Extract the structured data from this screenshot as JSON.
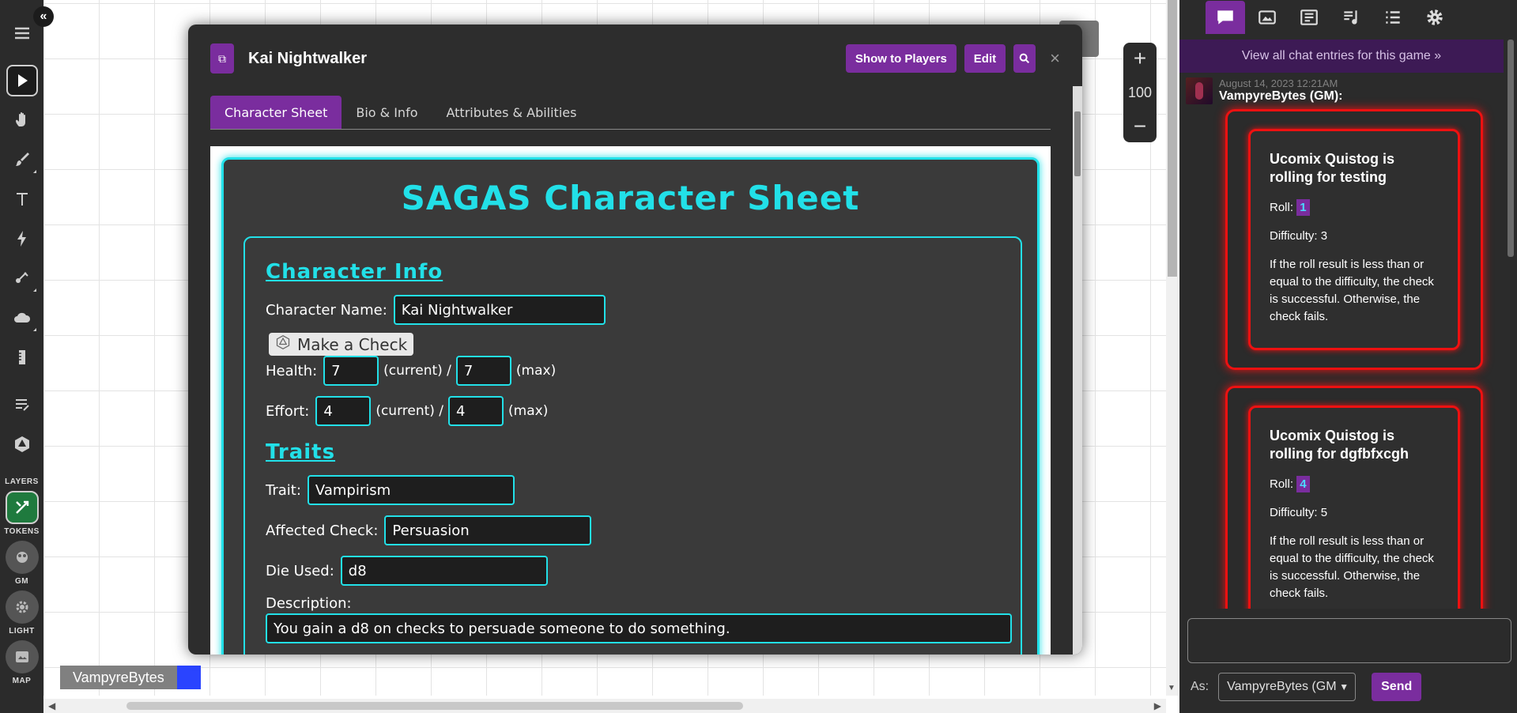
{
  "dialog": {
    "title": "Kai Nightwalker",
    "show_players_label": "Show to Players",
    "edit_label": "Edit",
    "close_glyph": "×",
    "tabs": [
      {
        "label": "Character Sheet"
      },
      {
        "label": "Bio & Info"
      },
      {
        "label": "Attributes & Abilities"
      }
    ]
  },
  "sheet": {
    "title": "SAGAS Character Sheet",
    "character_info_title": "Character Info",
    "name_label": "Character Name:",
    "name_value": "Kai Nightwalker",
    "make_check_label": "Make a Check",
    "health_label": "Health:",
    "health_current": "7",
    "current_label": "(current) /",
    "health_max": "7",
    "max_label": "(max)",
    "effort_label": "Effort:",
    "effort_current": "4",
    "effort_max": "4",
    "traits_title": "Traits",
    "trait_label": "Trait:",
    "trait_value": "Vampirism",
    "affected_check_label": "Affected Check:",
    "affected_check_value": "Persuasion",
    "die_used_label": "Die Used:",
    "die_used_value": "d8",
    "description_label": "Description:",
    "description_value": "You gain a d8 on checks to persuade someone to do something."
  },
  "zoom": {
    "plus": "+",
    "value": "100",
    "minus": "−"
  },
  "layers": {
    "layers_label": "LAYERS",
    "tokens_label": "TOKENS",
    "gm_label": "GM",
    "light_label": "LIGHT",
    "map_label": "MAP"
  },
  "player": {
    "name": "VampyreBytes",
    "color": "#2a44ff"
  },
  "chat": {
    "view_all": "View all chat entries for this game »",
    "timestamp": "August 14, 2023 12:21AM",
    "sender": "VampyreBytes (GM):",
    "rolls": [
      {
        "title": "Ucomix Quistog is rolling for testing",
        "roll_label": "Roll:",
        "roll_value": "1",
        "difficulty": "Difficulty: 3",
        "description": "If the roll result is less than or equal to the difficulty, the check is successful. Otherwise, the check fails."
      },
      {
        "title": "Ucomix Quistog is rolling for dgfbfxcgh",
        "roll_label": "Roll:",
        "roll_value": "4",
        "difficulty": "Difficulty: 5",
        "description": "If the roll result is less than or equal to the difficulty, the check is successful. Otherwise, the check fails."
      }
    ],
    "as_label": "As:",
    "as_value": "VampyreBytes (GM",
    "send_label": "Send"
  },
  "colors": {
    "accent": "#7a2d9e",
    "sheet_cyan": "#22e0e8",
    "roll_red": "#ee1111"
  }
}
